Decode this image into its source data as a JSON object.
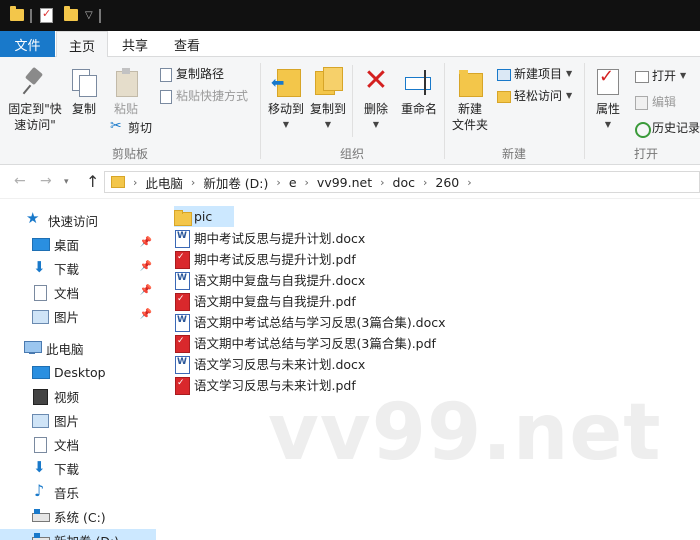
{
  "ribbon_tabs": {
    "file": "文件",
    "home": "主页",
    "share": "共享",
    "view": "查看"
  },
  "ribbon": {
    "clipboard": {
      "pin_quick_access": "固定到\"快\n速访问\"",
      "copy": "复制",
      "paste": "粘贴",
      "copy_path": "复制路径",
      "paste_shortcut": "粘贴快捷方式",
      "cut": "剪切",
      "label": "剪贴板"
    },
    "organize": {
      "move_to": "移动到",
      "copy_to": "复制到",
      "delete": "删除",
      "rename": "重命名",
      "label": "组织"
    },
    "new": {
      "new_folder": "新建\n文件夹",
      "new_item": "新建项目",
      "easy_access": "轻松访问",
      "label": "新建"
    },
    "open": {
      "properties": "属性",
      "open": "打开",
      "edit": "编辑",
      "history": "历史记录",
      "label": "打开"
    }
  },
  "address": {
    "crumbs": [
      "此电脑",
      "新加卷 (D:)",
      "e",
      "vv99.net",
      "doc",
      "260"
    ]
  },
  "nav": {
    "quick_access": "快速访问",
    "quick_items": [
      "桌面",
      "下载",
      "文档",
      "图片"
    ],
    "this_pc": "此电脑",
    "pc_items": [
      "Desktop",
      "视频",
      "图片",
      "文档",
      "下载",
      "音乐",
      "系统 (C:)",
      "新加卷 (D:)"
    ]
  },
  "files": [
    {
      "name": "pic",
      "type": "folder"
    },
    {
      "name": "期中考试反思与提升计划.docx",
      "type": "docx"
    },
    {
      "name": "期中考试反思与提升计划.pdf",
      "type": "pdf"
    },
    {
      "name": "语文期中复盘与自我提升.docx",
      "type": "docx"
    },
    {
      "name": "语文期中复盘与自我提升.pdf",
      "type": "pdf"
    },
    {
      "name": "语文期中考试总结与学习反思(3篇合集).docx",
      "type": "docx"
    },
    {
      "name": "语文期中考试总结与学习反思(3篇合集).pdf",
      "type": "pdf"
    },
    {
      "name": "语文学习反思与未来计划.docx",
      "type": "docx"
    },
    {
      "name": "语文学习反思与未来计划.pdf",
      "type": "pdf"
    }
  ],
  "watermark": "vv99.net",
  "colors": {
    "accent": "#1979ca",
    "selection": "#cce8ff",
    "folder": "#f3c64a",
    "pdf": "#d9282c"
  }
}
